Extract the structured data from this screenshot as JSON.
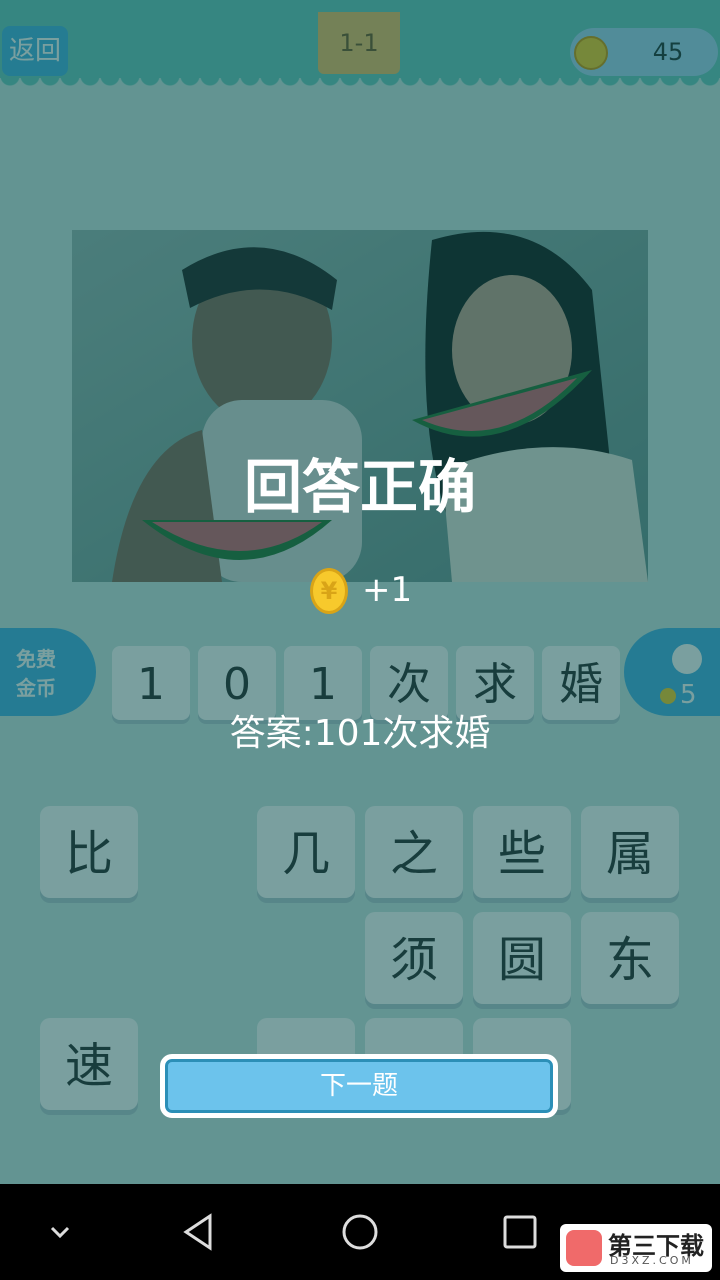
{
  "header": {
    "back_label": "返回",
    "level": "1-1",
    "coins": "45"
  },
  "side": {
    "free_coins_line1": "免费",
    "free_coins_line2": "金币",
    "hint_count": "5"
  },
  "answer_slots": [
    "1",
    "0",
    "1",
    "次",
    "求",
    "婚"
  ],
  "keys": {
    "row1": [
      "比",
      "几",
      "之",
      "些",
      "属"
    ],
    "row2": [
      "须",
      "圆",
      "东"
    ],
    "row3": [
      "速",
      "",
      "",
      ""
    ]
  },
  "result": {
    "title": "回答正确",
    "reward": "+1",
    "answer": "答案:101次求婚"
  },
  "next_button": "下一题",
  "watermark": {
    "title": "第三下载",
    "subtitle": "D3XZ.COM"
  },
  "colors": {
    "accent": "#4fb3e6",
    "header": "#72cbc0",
    "overlay": "#004646"
  }
}
